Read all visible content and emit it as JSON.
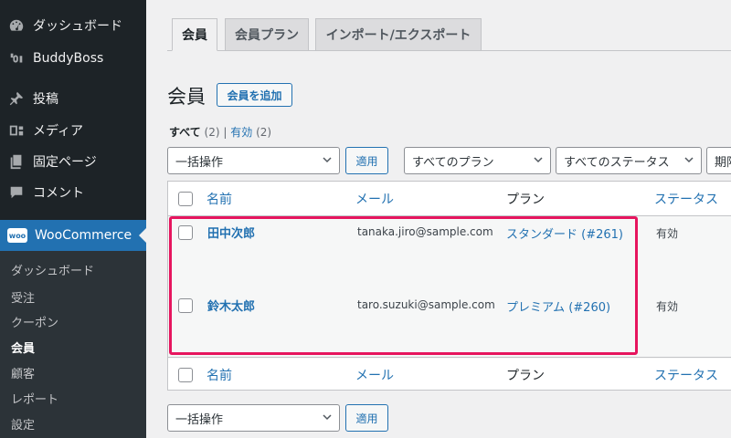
{
  "sidebar": {
    "items": [
      {
        "label": "ダッシュボード",
        "icon": "dashboard-icon"
      },
      {
        "label": "BuddyBoss",
        "icon": "buddyboss-icon"
      },
      {
        "label": "投稿",
        "icon": "pin-icon"
      },
      {
        "label": "メディア",
        "icon": "media-icon"
      },
      {
        "label": "固定ページ",
        "icon": "pages-icon"
      },
      {
        "label": "コメント",
        "icon": "comment-icon"
      }
    ],
    "woocommerce": {
      "label": "WooCommerce",
      "badge": "woo"
    },
    "submenu": [
      "ダッシュボード",
      "受注",
      "クーポン",
      "会員",
      "顧客",
      "レポート",
      "設定"
    ],
    "submenu_current": "会員"
  },
  "tabs": [
    "会員",
    "会員プラン",
    "インポート/エクスポート"
  ],
  "page": {
    "title": "会員",
    "add_button": "会員を追加"
  },
  "views": {
    "all_label": "すべて",
    "all_count": "(2)",
    "separator": "|",
    "active_label": "有効",
    "active_count": "(2)"
  },
  "filters": {
    "bulk_action": "一括操作",
    "apply": "適用",
    "plan_filter": "すべてのプラン",
    "status_filter": "すべてのステータス",
    "date_filter": "期限"
  },
  "table": {
    "columns": {
      "name": "名前",
      "email": "メール",
      "plan": "プラン",
      "status": "ステータス"
    },
    "rows": [
      {
        "name": "田中次郎",
        "email": "tanaka.jiro@sample.com",
        "plan": "スタンダード (#261)",
        "status": "有効"
      },
      {
        "name": "鈴木太郎",
        "email": "taro.suzuki@sample.com",
        "plan": "プレミアム (#260)",
        "status": "有効"
      }
    ]
  },
  "colors": {
    "accent": "#2271b1",
    "highlight": "#e6155e",
    "sidebar": "#1d2327"
  }
}
